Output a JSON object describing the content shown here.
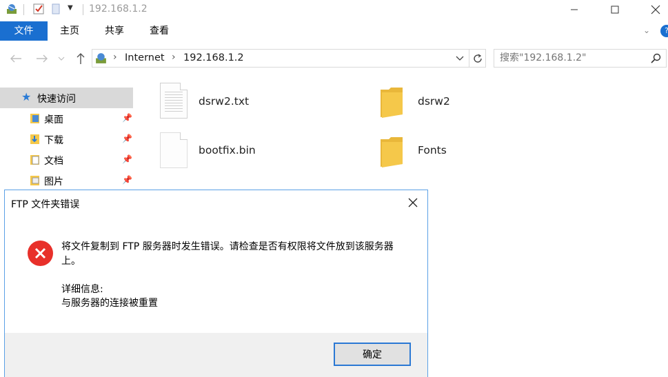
{
  "window": {
    "title": "192.168.1.2"
  },
  "ribbon": {
    "tabs": [
      "文件",
      "主页",
      "共享",
      "查看"
    ]
  },
  "address": {
    "crumbs": [
      "Internet",
      "192.168.1.2"
    ]
  },
  "search": {
    "placeholder": "搜索\"192.168.1.2\""
  },
  "nav": {
    "quick_access": "快速访问",
    "items": [
      "桌面",
      "下载",
      "文档",
      "图片"
    ]
  },
  "files": [
    {
      "name": "dsrw2.txt",
      "kind": "document"
    },
    {
      "name": "dsrw2",
      "kind": "folder"
    },
    {
      "name": "bootfix.bin",
      "kind": "blank"
    },
    {
      "name": "Fonts",
      "kind": "folder"
    }
  ],
  "dialog": {
    "title": "FTP 文件夹错误",
    "message": "将文件复制到 FTP 服务器时发生错误。请检查是否有权限将文件放到该服务器上。",
    "details_heading": "详细信息:",
    "details": "与服务器的连接被重置",
    "ok_label": "确定"
  },
  "colors": {
    "accent": "#1a6fd0",
    "error": "#e8302a",
    "folder": "#f5c84a"
  }
}
